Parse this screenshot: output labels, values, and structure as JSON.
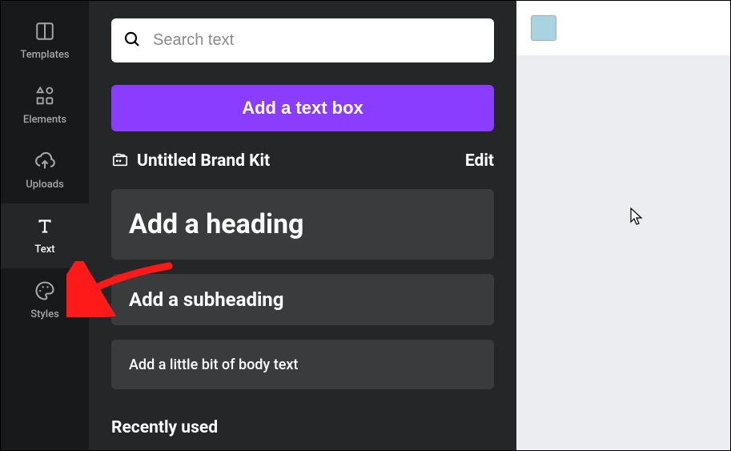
{
  "sidebar": {
    "items": [
      {
        "label": "Templates"
      },
      {
        "label": "Elements"
      },
      {
        "label": "Uploads"
      },
      {
        "label": "Text"
      },
      {
        "label": "Styles"
      }
    ]
  },
  "panel": {
    "search_placeholder": "Search text",
    "add_text_box_label": "Add a text box",
    "brand_kit_label": "Untitled Brand Kit",
    "edit_label": "Edit",
    "heading_card": "Add a heading",
    "subheading_card": "Add a subheading",
    "body_card": "Add a little bit of body text",
    "recently_used_label": "Recently used"
  },
  "colors": {
    "swatch": "#a9d3e0",
    "accent": "#8b3dff"
  }
}
